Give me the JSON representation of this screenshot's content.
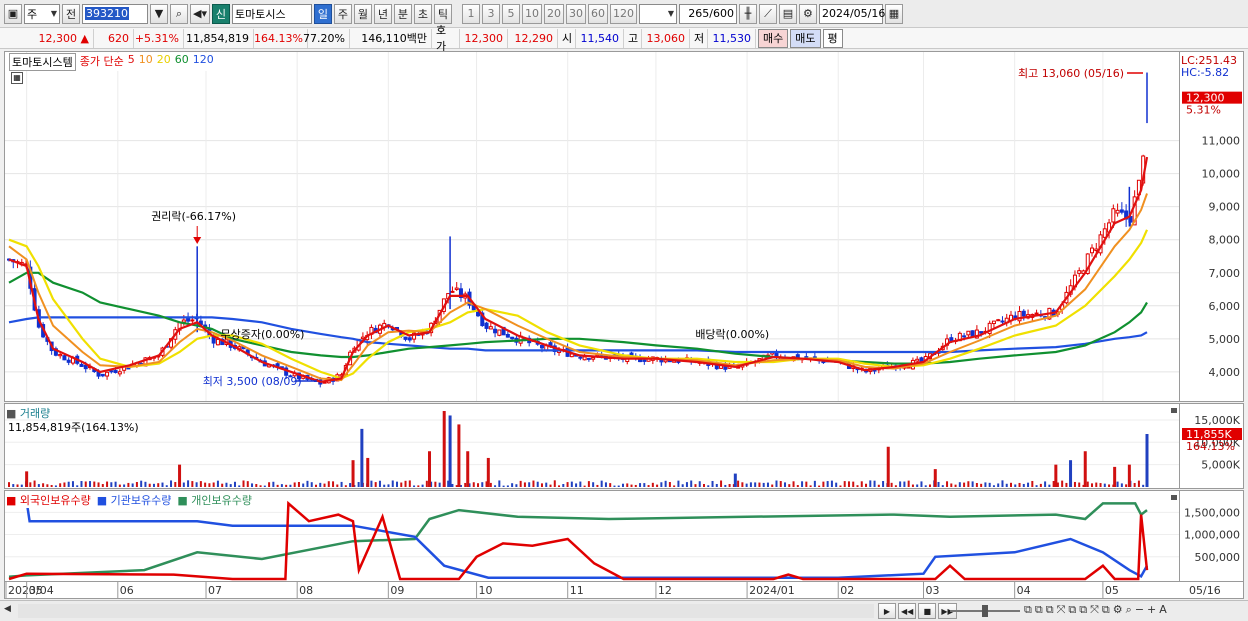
{
  "toolbar": {
    "type_label": "주",
    "prev_label": "전",
    "code_value": "393210",
    "new_badge": "신",
    "stock_name": "토마토시스",
    "periods": [
      "일",
      "주",
      "월",
      "년",
      "분",
      "초",
      "틱"
    ],
    "intervals": [
      "1",
      "3",
      "5",
      "10",
      "20",
      "30",
      "60",
      "120"
    ],
    "count_value": "265",
    "count_total": "/600",
    "date_value": "2024/05/16"
  },
  "quote": {
    "price": "12,300",
    "change": "620",
    "change_rate": "+5.31%",
    "volume": "11,854,819",
    "volume_rate": "164.13%",
    "turnover": "77.20%",
    "amount": "146,110백만",
    "ask_label": "호가",
    "ask1": "12,300",
    "ask2": "12,290",
    "open_label": "시",
    "open": "11,540",
    "high_label": "고",
    "high": "13,060",
    "low_label": "저",
    "low": "11,530",
    "buy_label": "매수",
    "sell_label": "매도",
    "avg_label": "평"
  },
  "colors": {
    "candle_up": "#e00000",
    "candle_down": "#1030d0",
    "ma5": "#e01010",
    "ma10": "#f09020",
    "ma20": "#f0e000",
    "ma60": "#109030",
    "ma120": "#2050e0"
  },
  "legend": {
    "main_name": "토마토시스템",
    "price_type": "종가 단순",
    "ma": [
      {
        "label": "5",
        "color": "#e01010"
      },
      {
        "label": "10",
        "color": "#f09020"
      },
      {
        "label": "20",
        "color": "#e8d000"
      },
      {
        "label": "60",
        "color": "#109030"
      },
      {
        "label": "120",
        "color": "#2050e0"
      }
    ]
  },
  "chart_data": [
    {
      "type": "candlestick",
      "title": "토마토시스템",
      "x_range": [
        "2023/04",
        "2024/05/16"
      ],
      "x_ticks": [
        "2023/04",
        "05",
        "06",
        "07",
        "08",
        "09",
        "10",
        "11",
        "12",
        "2024/01",
        "02",
        "03",
        "04",
        "05",
        "05/16"
      ],
      "ylim": [
        3300,
        13500
      ],
      "y_ticks": [
        4000,
        5000,
        6000,
        7000,
        8000,
        9000,
        10000,
        11000
      ],
      "y_tick_labels": [
        "4,000",
        "5,000",
        "6,000",
        "7,000",
        "8,000",
        "9,000",
        "10,000",
        "11,000"
      ],
      "close_points": [
        [
          "2023-04-25",
          7400
        ],
        [
          "2023-05-01",
          7200
        ],
        [
          "2023-05-05",
          5400
        ],
        [
          "2023-05-10",
          4600
        ],
        [
          "2023-05-20",
          4200
        ],
        [
          "2023-05-26",
          3900
        ],
        [
          "2023-06-05",
          4200
        ],
        [
          "2023-06-15",
          4500
        ],
        [
          "2023-06-22",
          5500
        ],
        [
          "2023-06-28",
          5600
        ],
        [
          "2023-07-03",
          5000
        ],
        [
          "2023-07-10",
          4800
        ],
        [
          "2023-07-20",
          4300
        ],
        [
          "2023-07-30",
          3900
        ],
        [
          "2023-08-09",
          3650
        ],
        [
          "2023-08-16",
          3900
        ],
        [
          "2023-08-20",
          4800
        ],
        [
          "2023-08-25",
          5200
        ],
        [
          "2023-09-01",
          5500
        ],
        [
          "2023-09-08",
          5000
        ],
        [
          "2023-09-15",
          5300
        ],
        [
          "2023-09-22",
          6500
        ],
        [
          "2023-09-28",
          6200
        ],
        [
          "2023-10-04",
          5400
        ],
        [
          "2023-10-15",
          5000
        ],
        [
          "2023-10-25",
          4700
        ],
        [
          "2023-11-05",
          4500
        ],
        [
          "2023-11-20",
          4400
        ],
        [
          "2023-12-01",
          4400
        ],
        [
          "2023-12-15",
          4300
        ],
        [
          "2023-12-28",
          4100
        ],
        [
          "2024-01-10",
          4500
        ],
        [
          "2024-01-20",
          4400
        ],
        [
          "2024-02-01",
          4300
        ],
        [
          "2024-02-10",
          4000
        ],
        [
          "2024-02-20",
          4200
        ],
        [
          "2024-03-01",
          4300
        ],
        [
          "2024-03-10",
          5000
        ],
        [
          "2024-03-20",
          5200
        ],
        [
          "2024-04-01",
          5700
        ],
        [
          "2024-04-15",
          5800
        ],
        [
          "2024-04-25",
          7300
        ],
        [
          "2024-05-05",
          8800
        ],
        [
          "2024-05-10",
          8600
        ],
        [
          "2024-05-14",
          9900
        ],
        [
          "2024-05-16",
          12300
        ]
      ],
      "moving_averages": [
        {
          "name": "5",
          "points": [
            7400,
            7200,
            5600,
            4700,
            4300,
            4000,
            4200,
            4500,
            5300,
            5500,
            5100,
            4800,
            4300,
            4000,
            3700,
            3800,
            4600,
            5100,
            5400,
            5100,
            5200,
            6300,
            6300,
            5600,
            5100,
            4800,
            4500,
            4400,
            4400,
            4300,
            4150,
            4450,
            4400,
            4300,
            4050,
            4150,
            4300,
            4900,
            5100,
            5600,
            5800,
            7000,
            8500,
            8700,
            9500,
            10500
          ]
        },
        {
          "name": "10",
          "points": [
            7800,
            7400,
            6400,
            5400,
            4600,
            4200,
            4150,
            4300,
            4900,
            5300,
            5200,
            4950,
            4500,
            4150,
            3800,
            3750,
            4200,
            4800,
            5200,
            5250,
            5200,
            5800,
            6100,
            5900,
            5400,
            5000,
            4600,
            4450,
            4400,
            4350,
            4200,
            4350,
            4400,
            4350,
            4150,
            4100,
            4250,
            4600,
            4950,
            5400,
            5700,
            6500,
            7800,
            8300,
            8900,
            9400
          ]
        },
        {
          "name": "20",
          "points": [
            8000,
            7800,
            7200,
            6200,
            5000,
            4400,
            4150,
            4250,
            4600,
            5000,
            5100,
            5100,
            4850,
            4400,
            4000,
            3800,
            3950,
            4400,
            4900,
            5200,
            5300,
            5500,
            5800,
            5900,
            5700,
            5200,
            4800,
            4500,
            4400,
            4400,
            4300,
            4300,
            4400,
            4400,
            4250,
            4150,
            4200,
            4400,
            4700,
            5100,
            5400,
            6000,
            6900,
            7400,
            7900,
            8300
          ]
        },
        {
          "name": "60",
          "points": [
            6700,
            7000,
            7000,
            6700,
            6400,
            6100,
            5900,
            5700,
            5500,
            5400,
            5300,
            5000,
            4800,
            4600,
            4500,
            4450,
            4450,
            4500,
            4600,
            4700,
            4750,
            4800,
            4850,
            4900,
            4950,
            5000,
            5000,
            4900,
            4800,
            4700,
            4550,
            4450,
            4400,
            4350,
            4300,
            4250,
            4250,
            4300,
            4400,
            4500,
            4600,
            4800,
            5200,
            5500,
            5800,
            6100
          ]
        },
        {
          "name": "120",
          "points": [
            5500,
            5600,
            5650,
            5650,
            5650,
            5650,
            5650,
            5650,
            5650,
            5650,
            5650,
            5600,
            5500,
            5300,
            5150,
            5050,
            5000,
            4900,
            4850,
            4800,
            4750,
            4700,
            4700,
            4650,
            4650,
            4650,
            4650,
            4650,
            4650,
            4650,
            4600,
            4600,
            4600,
            4600,
            4600,
            4600,
            4600,
            4600,
            4650,
            4700,
            4750,
            4850,
            5000,
            5050,
            5100,
            5200
          ]
        }
      ],
      "annotations": [
        {
          "label": "권리락(-66.17%)",
          "date": "2023-06-28"
        },
        {
          "label": "무상증자(0.00%)",
          "date": "2023-07-10"
        },
        {
          "label": "최저 3,500 (08/09)",
          "date": "2023-08-09",
          "value": 3500
        },
        {
          "label": "배당락(0.00%)",
          "date": "2023-12-28"
        },
        {
          "label": "최고 13,060 (05/16)",
          "date": "2024-05-16",
          "value": 13060
        }
      ],
      "right_labels": {
        "lc": "LC:251.43",
        "hc": "HC:-5.82",
        "last_price": "12,300",
        "last_rate": "5.31%"
      }
    },
    {
      "type": "bar",
      "title": "거래량",
      "current_label": "11,854,819주(164.13%)",
      "y_tick_labels": [
        "15,000K",
        "10,000K",
        "5,000K"
      ],
      "y_ticks": [
        15000,
        10000,
        5000
      ],
      "ylim": [
        0,
        17000
      ],
      "unit": "K",
      "spikes": [
        [
          "2023-05-01",
          3500
        ],
        [
          "2023-06-22",
          5000
        ],
        [
          "2023-08-20",
          6000
        ],
        [
          "2023-08-23",
          13000
        ],
        [
          "2023-08-25",
          6500
        ],
        [
          "2023-09-15",
          8000
        ],
        [
          "2023-09-20",
          17000
        ],
        [
          "2023-09-22",
          16000
        ],
        [
          "2023-09-25",
          14000
        ],
        [
          "2023-09-28",
          8000
        ],
        [
          "2023-10-05",
          6500
        ],
        [
          "2023-12-28",
          3000
        ],
        [
          "2024-02-18",
          9000
        ],
        [
          "2024-03-05",
          4000
        ],
        [
          "2024-04-15",
          5000
        ],
        [
          "2024-04-20",
          6000
        ],
        [
          "2024-04-25",
          8000
        ],
        [
          "2024-05-05",
          4500
        ],
        [
          "2024-05-10",
          5000
        ],
        [
          "2024-05-16",
          11855
        ]
      ],
      "right_labels": {
        "current": "11,855K",
        "rate": "164.13%"
      }
    },
    {
      "type": "line",
      "series": [
        {
          "name": "외국인보유수량",
          "color": "#e00000"
        },
        {
          "name": "기관보유수량",
          "color": "#2050e0"
        },
        {
          "name": "개인보유수량",
          "color": "#2f8f5a"
        }
      ],
      "y_tick_labels": [
        "1,500,000",
        "1,000,000",
        "500,000"
      ],
      "y_ticks": [
        1500000,
        1000000,
        500000
      ],
      "ylim": [
        0,
        1800000
      ]
    }
  ],
  "bottom": {
    "date_label": "05/16"
  }
}
